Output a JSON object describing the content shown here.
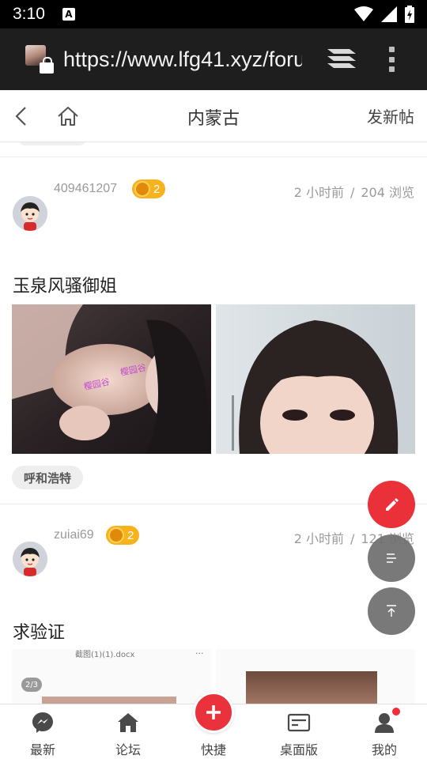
{
  "status_bar": {
    "time": "3:10",
    "notification_icon": "A"
  },
  "browser": {
    "url": "https://www.lfg41.xyz/forum"
  },
  "nav": {
    "title": "内蒙古",
    "new_post": "发新帖"
  },
  "posts": [
    {
      "username": "409461207",
      "level": "2",
      "time": "2 小时前",
      "separator": "/",
      "views": "204 浏览",
      "title": "玉泉风骚御姐",
      "location": "呼和浩特",
      "watermark": "樱园谷"
    },
    {
      "username": "zuiai69",
      "level": "2",
      "time": "2 小时前",
      "separator": "/",
      "views": "121 浏览",
      "title": "求验证",
      "thumb_counter": "2/3",
      "thumb_filename": "截图(1)(1).docx",
      "thumb_ellipsis": "..."
    }
  ],
  "bottom_nav": [
    {
      "label": "最新",
      "icon": "messenger-icon"
    },
    {
      "label": "论坛",
      "icon": "home-icon"
    },
    {
      "label": "快捷",
      "icon": "plus-icon"
    },
    {
      "label": "桌面版",
      "icon": "desktop-card-icon"
    },
    {
      "label": "我的",
      "icon": "user-icon"
    }
  ],
  "colors": {
    "accent": "#e9323c",
    "badge": "#f7b21c",
    "fab_gray": "#6e6e6e"
  }
}
